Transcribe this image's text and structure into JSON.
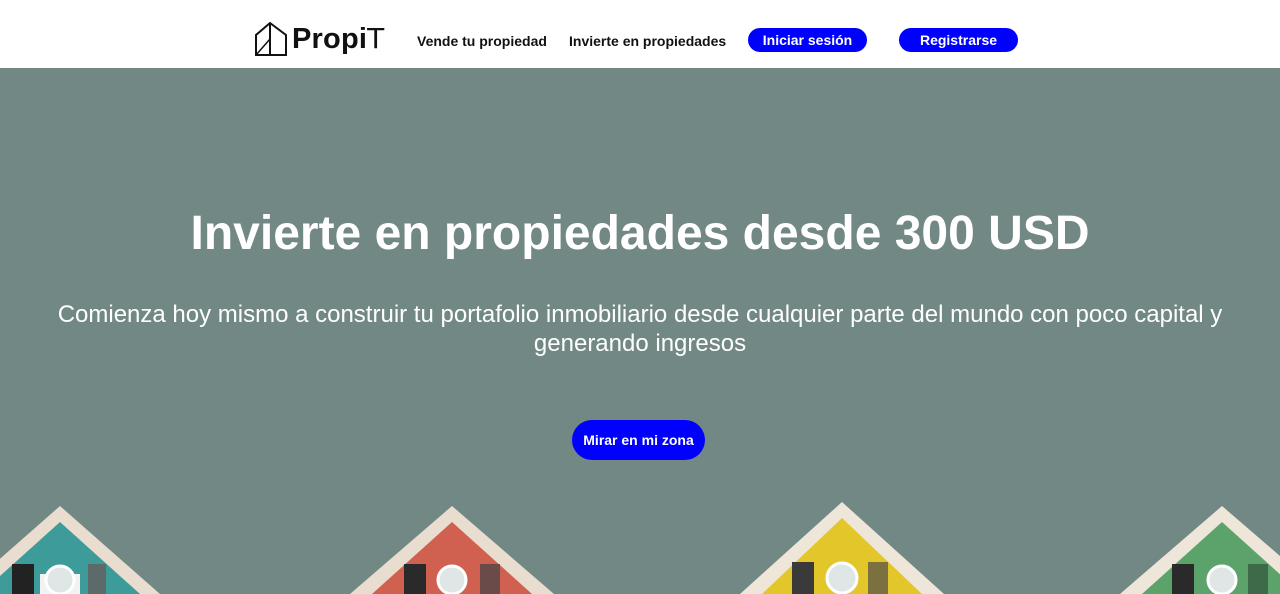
{
  "header": {
    "logo": {
      "bold": "Propi",
      "thin": "T"
    },
    "nav": {
      "sell": "Vende tu propiedad",
      "invest": "Invierte en propiedades"
    },
    "login_label": "Iniciar sesión",
    "register_label": "Registrarse"
  },
  "hero": {
    "title": "Invierte en propiedades desde 300 USD",
    "subtitle": "Comienza hoy mismo a construir tu portafolio inmobiliario desde cualquier parte del mundo con poco capital y generando ingresos",
    "cta_label": "Mirar en mi zona"
  },
  "colors": {
    "accent": "#0000ff",
    "hero_bg": "#728884",
    "text_on_hero": "#ffffff"
  },
  "icons": [
    "house-logo-icon"
  ]
}
